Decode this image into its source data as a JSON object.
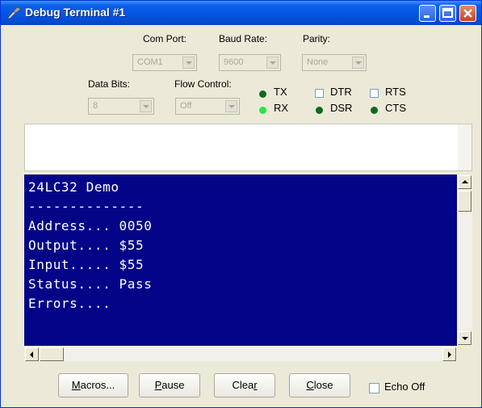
{
  "window": {
    "title": "Debug Terminal #1"
  },
  "settings": {
    "com_port": {
      "label": "Com Port:",
      "value": "COM1"
    },
    "baud_rate": {
      "label": "Baud Rate:",
      "value": "9600"
    },
    "parity": {
      "label": "Parity:",
      "value": "None"
    },
    "data_bits": {
      "label": "Data Bits:",
      "value": "8"
    },
    "flow_control": {
      "label": "Flow Control:",
      "value": "Off"
    }
  },
  "indicators": {
    "tx": "TX",
    "rx": "RX",
    "dtr": "DTR",
    "rts": "RTS",
    "dsr": "DSR",
    "cts": "CTS"
  },
  "terminal": {
    "lines": [
      "24LC32 Demo",
      "--------------",
      "Address... 0050",
      "Output.... $55",
      "Input..... $55",
      "Status.... Pass",
      "Errors...."
    ]
  },
  "buttons": {
    "macros": {
      "pre": "",
      "key": "M",
      "post": "acros..."
    },
    "pause": {
      "pre": "",
      "key": "P",
      "post": "ause"
    },
    "clear": {
      "pre": "Clea",
      "key": "r",
      "post": ""
    },
    "close": {
      "pre": "",
      "key": "C",
      "post": "lose"
    }
  },
  "echo_off": {
    "label": "Echo Off"
  },
  "colors": {
    "terminal_bg": "#040488",
    "terminal_fg": "#ffffff",
    "led_on": "#1fe84a",
    "led_off": "#0a6b1c"
  }
}
